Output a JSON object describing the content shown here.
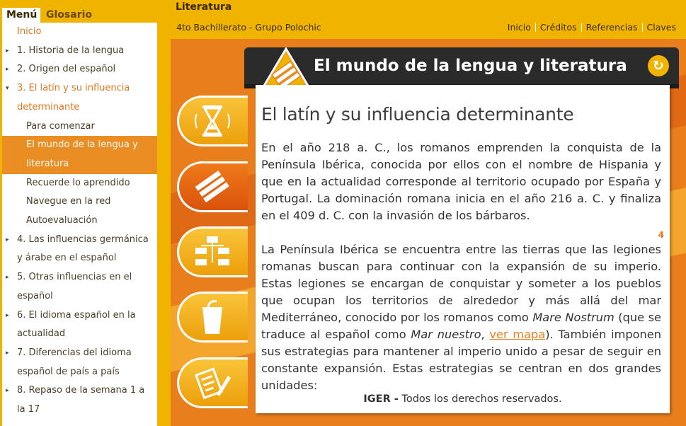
{
  "sidebar": {
    "tabs": {
      "menu": "Menú",
      "glossary": "Glosario"
    },
    "items": [
      {
        "label": "Inicio",
        "arrow": "",
        "level": 0,
        "state": "orange"
      },
      {
        "label": "1. Historia de la lengua",
        "arrow": "▸",
        "level": 0,
        "state": "normal"
      },
      {
        "label": "2. Origen del español",
        "arrow": "▸",
        "level": 0,
        "state": "normal"
      },
      {
        "label": "3. El latín y su influencia determinante",
        "arrow": "▾",
        "level": 0,
        "state": "orange"
      },
      {
        "label": "Para comenzar",
        "arrow": "",
        "level": 1,
        "state": "normal"
      },
      {
        "label": "El mundo de la lengua y literatura",
        "arrow": "",
        "level": 1,
        "state": "selected"
      },
      {
        "label": "Recuerde lo aprendido",
        "arrow": "",
        "level": 1,
        "state": "normal"
      },
      {
        "label": "Navegue en la red",
        "arrow": "",
        "level": 1,
        "state": "normal"
      },
      {
        "label": "Autoevaluación",
        "arrow": "",
        "level": 1,
        "state": "normal"
      },
      {
        "label": "4. Las influencias germánica y árabe en el español",
        "arrow": "▸",
        "level": 0,
        "state": "normal"
      },
      {
        "label": "5. Otras influencias en el español",
        "arrow": "▸",
        "level": 0,
        "state": "normal"
      },
      {
        "label": "6. El idioma español en la actualidad",
        "arrow": "▸",
        "level": 0,
        "state": "normal"
      },
      {
        "label": "7. Diferencias del idioma español de país a país",
        "arrow": "▸",
        "level": 0,
        "state": "normal"
      },
      {
        "label": "8. Repaso de la semana 1 a la 17",
        "arrow": "▸",
        "level": 0,
        "state": "normal"
      }
    ]
  },
  "header": {
    "title": "Literatura",
    "subtitle": "4to Bachillerato - Grupo Polochic",
    "nav": [
      "Inicio",
      "Créditos",
      "Referencias",
      "Claves"
    ]
  },
  "banner": {
    "title": "El mundo de la lengua y literatura",
    "reload_icon": "↻"
  },
  "content": {
    "heading": "El latín y su influencia determinante",
    "p1": "En el año 218 a. C., los romanos emprenden la conquista de la Península Ibérica, conocida por ellos con el nombre de Hispania y que en la actualidad corresponde al territorio ocupado por España y Portugal. La dominación romana inicia en el año 216 a. C. y finaliza en el 409 d. C. con la invasión de los bárbaros.",
    "p2_a": "La Península Ibérica se encuentra entre las tierras que las legiones romanas buscan para continuar con la expansión de su imperio. Estas legiones se encargan de conquistar y someter a los pueblos que ocupan los territorios de alrededor y más allá del mar Mediterráneo, conocido por los romanos como ",
    "p2_em1": "Mare Nostrum",
    "p2_b": " (que se traduce al español como ",
    "p2_em2": "Mar nuestro",
    "p2_c": ", ",
    "p2_link": "ver mapa",
    "p2_d": "). También imponen sus estrategias para mantener al imperio unido a pesar de seguir en constante expansión. Estas estrategias se centran en dos grandes unidades:",
    "page_number": "4",
    "footer_brand": "IGER -",
    "footer_text": " Todos los derechos reservados."
  },
  "side_buttons": [
    "hourglass-icon",
    "books-icon",
    "diagram-icon",
    "cup-icon",
    "write-icon"
  ],
  "colors": {
    "accent": "#f0b400",
    "orange": "#e97f1c",
    "selected": "#ea8d23",
    "banner": "#2b2b2b"
  }
}
